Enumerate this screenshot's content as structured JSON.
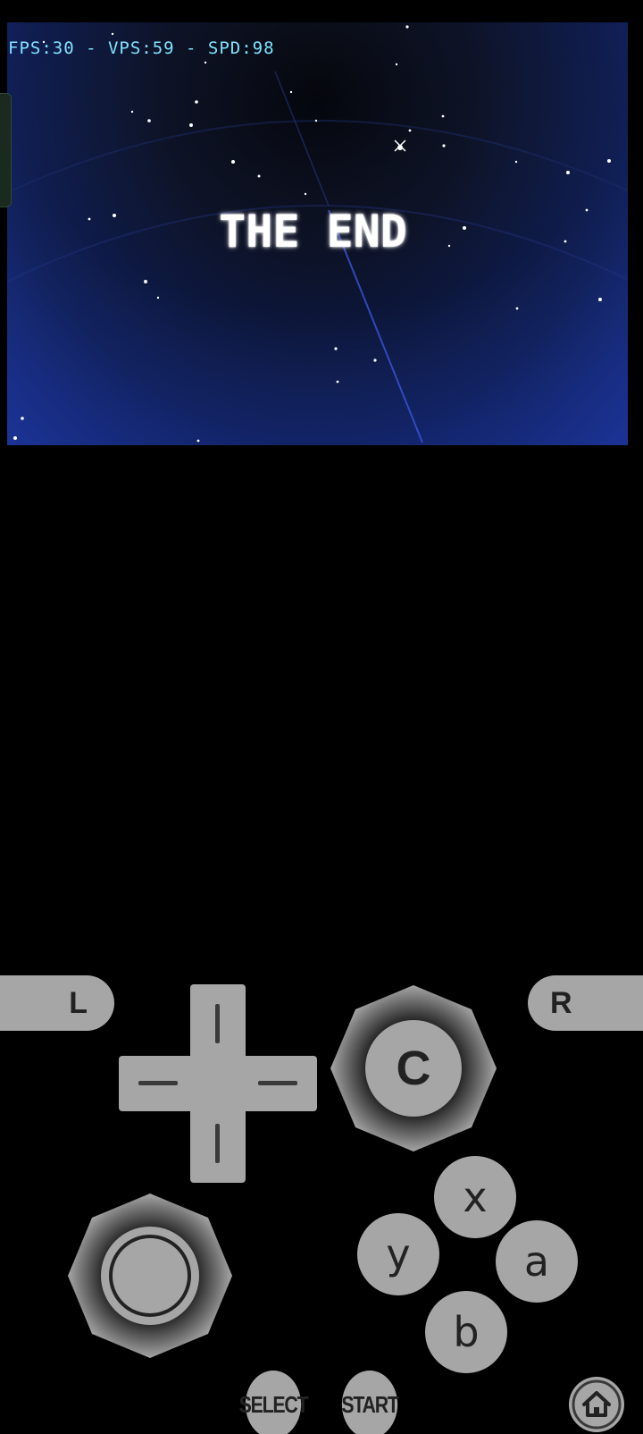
{
  "game_screen": {
    "stats": "FPS:30 - VPS:59 - SPD:98",
    "title_text": "THE END"
  },
  "controls": {
    "l_label": "L",
    "r_label": "R",
    "c_label": "C",
    "x_label": "x",
    "y_label": "y",
    "a_label": "a",
    "b_label": "b",
    "select_label": "SELECT",
    "start_label": "START"
  },
  "colors": {
    "button_fill": "#a6a6a6",
    "stats_text": "#7fe3ff",
    "background": "#000000"
  },
  "icons": [
    "dpad-icon",
    "analog-stick-icon",
    "home-icon"
  ]
}
